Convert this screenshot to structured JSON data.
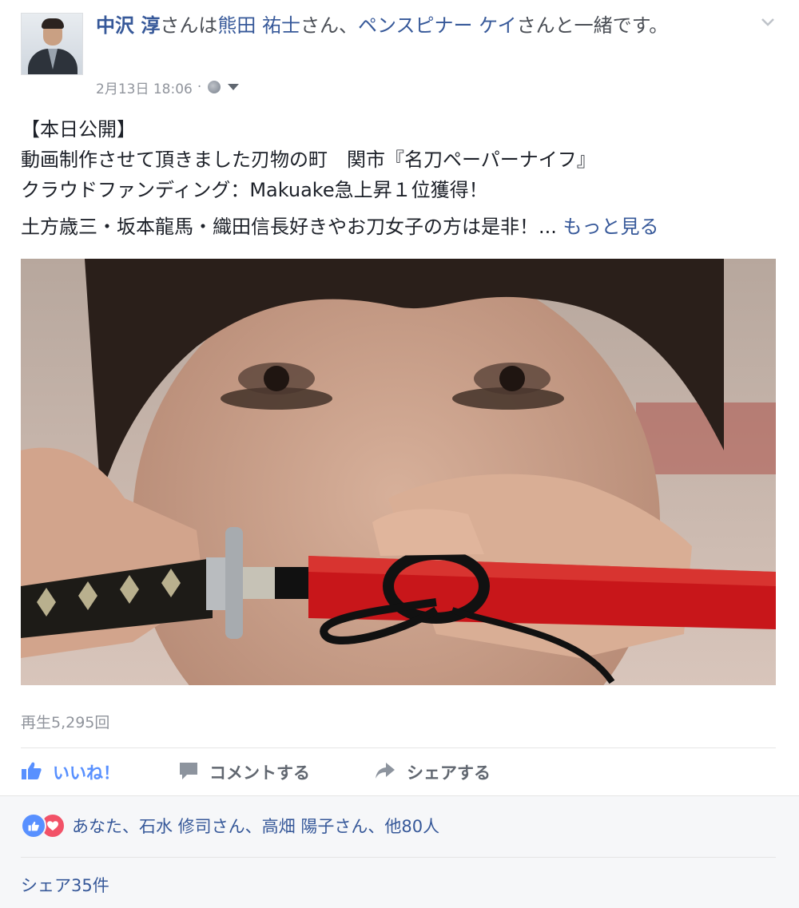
{
  "header": {
    "author": "中沢 淳",
    "mid1": "さんは",
    "tagged1": "熊田 祐士",
    "mid2": "さん、",
    "tagged2": "ペンスピナー ケイ",
    "tail": "さんと一緒です。",
    "date": "2月13日 18:06",
    "dot": "·"
  },
  "post": {
    "line1": "【本日公開】",
    "line2": "動画制作させて頂きました刃物の町　関市『名刀ペーパーナイフ』",
    "line3": "クラウドファンディング：Makuake急上昇１位獲得！",
    "line4": "土方歳三・坂本龍馬・織田信長好きやお刀女子の方は是非！...",
    "see_more": "もっと見る"
  },
  "video": {
    "views": "再生5,295回"
  },
  "actions": {
    "like": "いいね！",
    "comment": "コメントする",
    "share": "シェアする"
  },
  "footer": {
    "reactions_text": "あなた、石水 修司さん、高畑 陽子さん、他80人",
    "shares": "シェア35件"
  },
  "colors": {
    "link": "#365899",
    "like_blue": "#5890ff",
    "love_red": "#f25268"
  }
}
